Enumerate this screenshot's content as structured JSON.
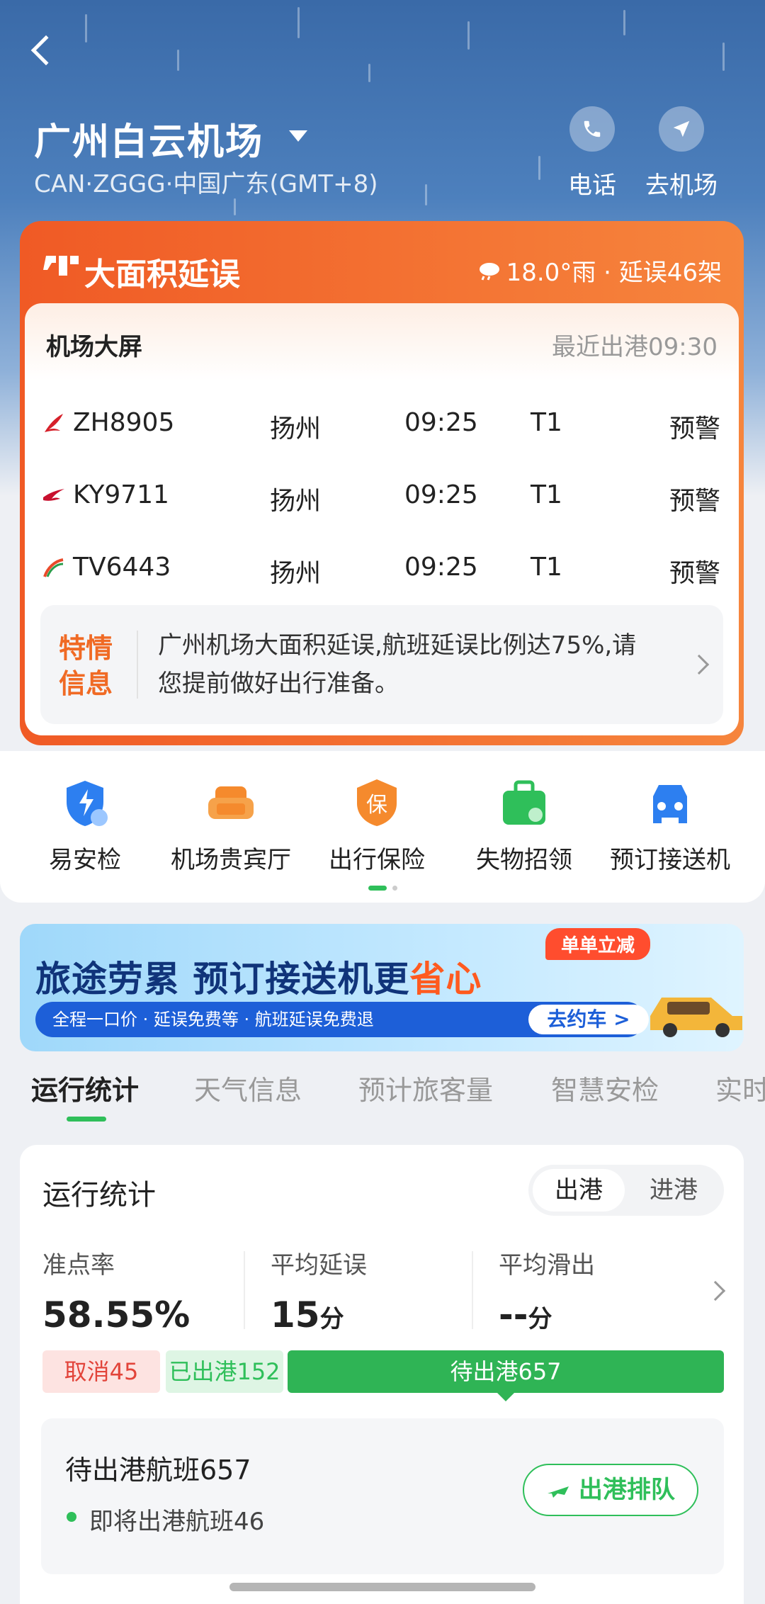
{
  "header": {
    "airport_name": "广州白云机场",
    "airport_code": "CAN·ZGGG·中国广东(GMT+8)",
    "actions": [
      {
        "label": "电话",
        "icon": "phone-icon"
      },
      {
        "label": "去机场",
        "icon": "navigate-icon"
      }
    ]
  },
  "delay_card": {
    "title": "大面积延误",
    "weather": "18.0°雨 · 延误46架",
    "screen_title": "机场大屏",
    "latest_departure": "最近出港09:30",
    "flights": [
      {
        "flight": "ZH8905",
        "city": "扬州",
        "time": "09:25",
        "terminal": "T1",
        "status": "预警",
        "logo_color": "#d6202a"
      },
      {
        "flight": "KY9711",
        "city": "扬州",
        "time": "09:25",
        "terminal": "T1",
        "status": "预警",
        "logo_color": "#c8102e"
      },
      {
        "flight": "TV6443",
        "city": "扬州",
        "time": "09:25",
        "terminal": "T1",
        "status": "预警",
        "logo_color": "#e94a2a"
      }
    ],
    "notice_tag": "特情信息",
    "notice_text": "广州机场大面积延误,航班延误比例达75%,请您提前做好出行准备。"
  },
  "services": [
    {
      "label": "易安检",
      "icon": "security-shield-icon"
    },
    {
      "label": "机场贵宾厅",
      "icon": "lounge-sofa-icon"
    },
    {
      "label": "出行保险",
      "icon": "insurance-icon"
    },
    {
      "label": "失物招领",
      "icon": "lost-found-bag-icon"
    },
    {
      "label": "预订接送机",
      "icon": "car-icon"
    }
  ],
  "banner": {
    "title_part1": "旅途劳累 预订接送机更",
    "title_highlight": "省心",
    "badge": "单单立减",
    "features": "全程一口价 · 延误免费等 · 航班延误免费退",
    "button": "去约车 >"
  },
  "tabs": [
    "运行统计",
    "天气信息",
    "预计旅客量",
    "智慧安检",
    "实时"
  ],
  "stats": {
    "title": "运行统计",
    "segment": [
      "出港",
      "进港"
    ],
    "metrics": [
      {
        "label": "准点率",
        "value": "58.55%",
        "unit": ""
      },
      {
        "label": "平均延误",
        "value": "15",
        "unit": "分"
      },
      {
        "label": "平均滑出",
        "value": "--",
        "unit": "分"
      }
    ],
    "bars": {
      "cancelled": "取消45",
      "departed": "已出港152",
      "pending": "待出港657"
    },
    "pending_title": "待出港航班657",
    "pending_sub": "即将出港航班46",
    "queue_button": "出港排队"
  },
  "colors": {
    "accent_green": "#2fbf5a",
    "delay_orange": "#f05a25",
    "cancel_red": "#e2443a"
  }
}
